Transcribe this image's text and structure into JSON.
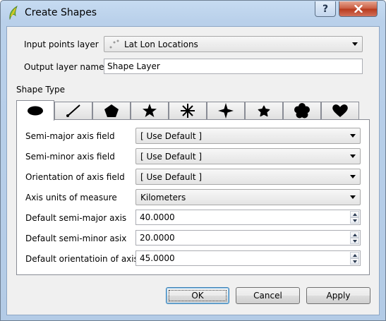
{
  "window": {
    "title": "Create Shapes",
    "help_icon": "help-icon",
    "close_icon": "close-icon"
  },
  "input_layer": {
    "label": "Input points layer",
    "value": "Lat Lon Locations",
    "icon": "point-layer-icon"
  },
  "output_layer": {
    "label": "Output layer name",
    "value": "Shape Layer"
  },
  "shape_type": {
    "label": "Shape Type",
    "tabs": [
      {
        "name": "ellipse",
        "icon": "ellipse-icon",
        "active": true
      },
      {
        "name": "line",
        "icon": "line-icon"
      },
      {
        "name": "pentagon",
        "icon": "pentagon-icon"
      },
      {
        "name": "star",
        "icon": "star-icon"
      },
      {
        "name": "asterisk",
        "icon": "asterisk-icon"
      },
      {
        "name": "four-point-star",
        "icon": "four-point-star-icon"
      },
      {
        "name": "small-star",
        "icon": "small-star-icon"
      },
      {
        "name": "flower",
        "icon": "flower-icon"
      },
      {
        "name": "heart",
        "icon": "heart-icon"
      }
    ]
  },
  "fields": {
    "semi_major_field": {
      "label": "Semi-major axis field",
      "value": "[ Use Default ]"
    },
    "semi_minor_field": {
      "label": "Semi-minor axis field",
      "value": "[ Use Default ]"
    },
    "orientation_field": {
      "label": "Orientation of axis field",
      "value": "[ Use Default ]"
    },
    "units": {
      "label": "Axis units of measure",
      "value": "Kilometers"
    },
    "default_semi_major": {
      "label": "Default semi-major axis",
      "value": "40.0000"
    },
    "default_semi_minor": {
      "label": "Default semi-minor asix",
      "value": "20.0000"
    },
    "default_orientation": {
      "label": "Default orientatioin of axis",
      "value": "45.0000"
    }
  },
  "buttons": {
    "ok": "OK",
    "cancel": "Cancel",
    "apply": "Apply"
  }
}
